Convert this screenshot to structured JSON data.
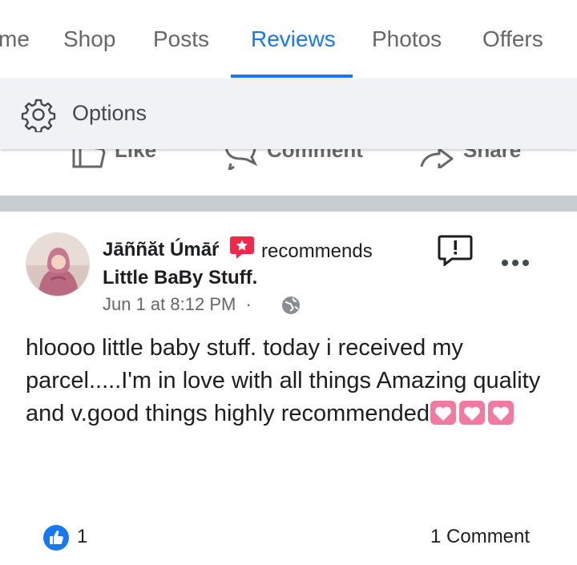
{
  "tabs": [
    {
      "label": "me",
      "active": false
    },
    {
      "label": "Shop",
      "active": false
    },
    {
      "label": "Posts",
      "active": false
    },
    {
      "label": "Reviews",
      "active": true
    },
    {
      "label": "Photos",
      "active": false
    },
    {
      "label": "Offers",
      "active": false
    }
  ],
  "options": {
    "label": "Options",
    "icon": "gear-icon"
  },
  "actions": [
    {
      "label": "Like",
      "icon": "thumbs-up-icon"
    },
    {
      "label": "Comment",
      "icon": "comment-icon"
    },
    {
      "label": "Share",
      "icon": "share-icon"
    }
  ],
  "post": {
    "author": "Jāññăt Úmāŕ",
    "verb": "recommends",
    "page": "Little BaBy Stuff.",
    "date": "Jun 1 at 8:12 PM",
    "separator": "·",
    "audience_icon": "globe-icon",
    "text": "hloooo little baby stuff. today i received my parcel.....I'm in love with all things Amazing quality and v.good things highly recommended",
    "emoji": [
      "heart-emoji",
      "heart-emoji",
      "heart-emoji"
    ],
    "likes": "1",
    "comments": "1 Comment"
  },
  "colors": {
    "accent": "#1877f2",
    "muted_text": "#65676b",
    "options_bg": "#f0f2f5",
    "divider": "#c9ccd1",
    "recommend_badge": "#f02849",
    "heart_emoji": "#f27aa0"
  }
}
